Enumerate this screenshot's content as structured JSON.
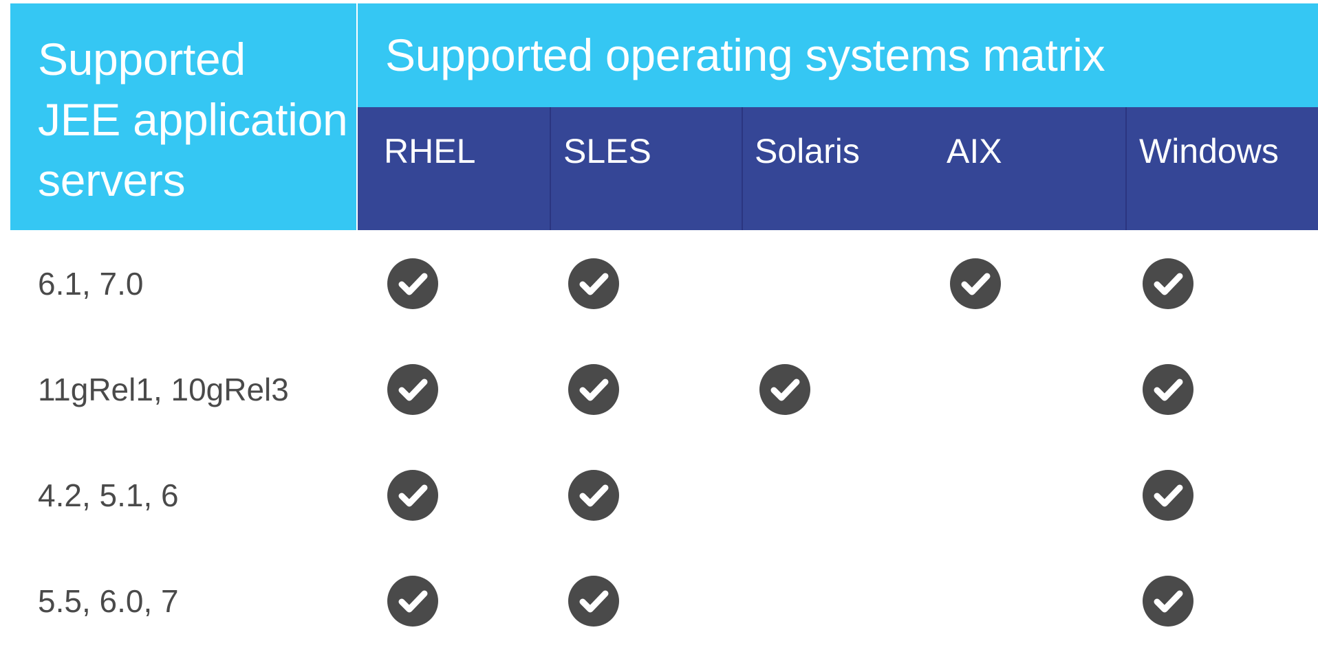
{
  "colors": {
    "cyan": "#35c7f3",
    "navy": "#354696",
    "check_fill": "#4a4a4a",
    "text_dark": "#4a4a4a"
  },
  "left_header": {
    "lines": [
      "Supported",
      "JEE application",
      "servers"
    ]
  },
  "title": "Supported operating systems matrix",
  "os_columns": [
    "RHEL",
    "SLES",
    "Solaris",
    "AIX",
    "Windows"
  ],
  "check_icon": "check-circle-icon",
  "rows": [
    {
      "label": "6.1, 7.0",
      "supported": [
        true,
        true,
        false,
        true,
        true
      ]
    },
    {
      "label": "11gRel1, 10gRel3",
      "supported": [
        true,
        true,
        true,
        false,
        true
      ]
    },
    {
      "label": "4.2, 5.1, 6",
      "supported": [
        true,
        true,
        false,
        false,
        true
      ]
    },
    {
      "label": "5.5, 6.0, 7",
      "supported": [
        true,
        true,
        false,
        false,
        true
      ]
    }
  ]
}
